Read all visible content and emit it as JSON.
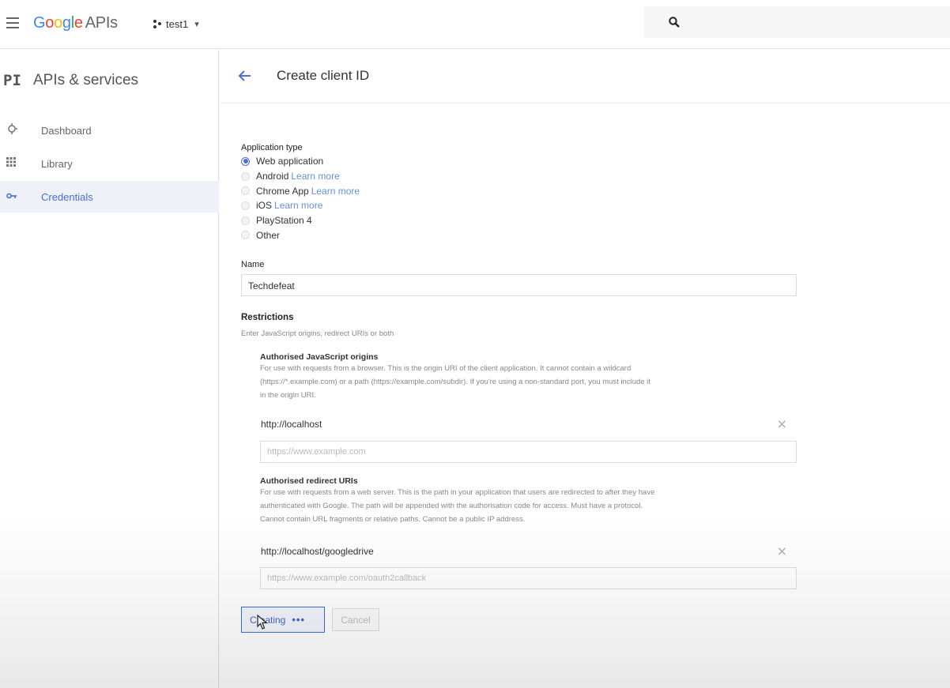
{
  "topbar": {
    "logo_google": "Google",
    "logo_apis": "APIs",
    "project_name": "test1",
    "project_caret": "▾"
  },
  "sidebar": {
    "prefix": "PI",
    "title": "APIs & services",
    "items": [
      {
        "label": "Dashboard",
        "icon": "dashboard-icon"
      },
      {
        "label": "Library",
        "icon": "library-icon"
      },
      {
        "label": "Credentials",
        "icon": "key-icon",
        "active": true
      }
    ]
  },
  "header": {
    "title": "Create client ID"
  },
  "form": {
    "app_type_label": "Application type",
    "app_types": [
      {
        "label": "Web application",
        "selected": true,
        "link": ""
      },
      {
        "label": "Android",
        "selected": false,
        "link": "Learn more"
      },
      {
        "label": "Chrome App",
        "selected": false,
        "link": "Learn more"
      },
      {
        "label": "iOS",
        "selected": false,
        "link": "Learn more"
      },
      {
        "label": "PlayStation 4",
        "selected": false,
        "link": ""
      },
      {
        "label": "Other",
        "selected": false,
        "link": ""
      }
    ],
    "name_label": "Name",
    "name_value": "Techdefeat",
    "restrictions_label": "Restrictions",
    "restrictions_hint": "Enter JavaScript origins, redirect URIs or both",
    "js_origins": {
      "label": "Authorised JavaScript origins",
      "desc_1": "For use with requests from a browser. This is the origin URI of the client application. It cannot contain a wildcard",
      "desc_2": "(https://*.example.com) or a path (https://example.com/subdir). If you're using a non-standard port, you must include it",
      "desc_3": "in the origin URI.",
      "value": "http://localhost",
      "placeholder": "https://www.example.com"
    },
    "redirect_uris": {
      "label": "Authorised redirect URIs",
      "desc_1": "For use with requests from a web server. This is the path in your application that users are redirected to after they have",
      "desc_2": "authenticated with Google. The path will be appended with the authorisation code for access. Must have a protocol.",
      "desc_3": "Cannot contain URL fragments or relative paths. Cannot be a public IP address.",
      "value": "http://localhost/googledrive",
      "placeholder": "https://www.example.com/oauth2callback"
    },
    "remove_symbol": "×",
    "create_button": "Creating",
    "create_dots": "•••",
    "cancel_button": "Cancel"
  },
  "colors": {
    "accent": "#4a6fd0",
    "link": "#6b8fd8",
    "active_bg": "#eef1f7"
  }
}
